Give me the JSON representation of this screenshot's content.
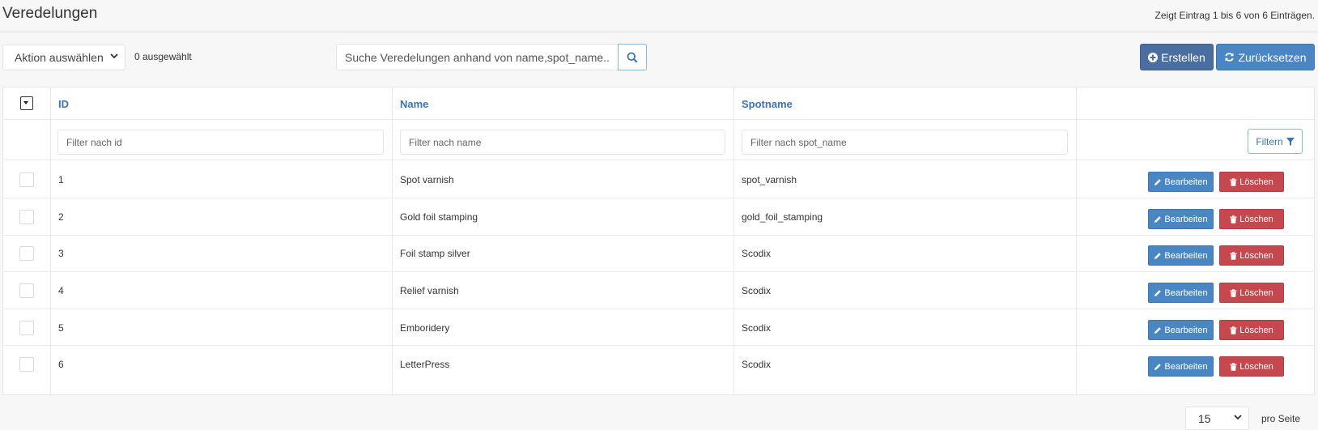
{
  "page": {
    "title": "Veredelungen",
    "summary": "Zeigt Eintrag 1 bis 6 von 6 Einträgen."
  },
  "toolbar": {
    "action_select": "Aktion auswählen",
    "selected_count": "0 ausgewählt",
    "search_placeholder": "Suche Veredelungen anhand von name,spot_name...",
    "create_label": "Erstellen",
    "reset_label": "Zurücksetzen"
  },
  "table": {
    "columns": [
      "ID",
      "Name",
      "Spotname"
    ],
    "filters": {
      "id_placeholder": "Filter nach id",
      "name_placeholder": "Filter nach name",
      "spot_placeholder": "Filter nach spot_name",
      "filter_button": "Filtern"
    },
    "edit_label": "Bearbeiten",
    "delete_label": "Löschen",
    "rows": [
      {
        "id": "1",
        "name": "Spot varnish",
        "spotname": "spot_varnish"
      },
      {
        "id": "2",
        "name": "Gold foil stamping",
        "spotname": "gold_foil_stamping"
      },
      {
        "id": "3",
        "name": "Foil stamp silver",
        "spotname": "Scodix"
      },
      {
        "id": "4",
        "name": "Relief varnish",
        "spotname": "Scodix"
      },
      {
        "id": "5",
        "name": "Emboridery",
        "spotname": "Scodix"
      },
      {
        "id": "6",
        "name": "LetterPress",
        "spotname": "Scodix"
      }
    ]
  },
  "pagination": {
    "per_page_value": "15",
    "per_page_label": "pro Seite"
  },
  "icons": {
    "search": "search-icon",
    "create": "plus-circle-icon",
    "reset": "refresh-icon",
    "filter": "filter-icon",
    "edit": "pencil-icon",
    "delete": "trash-icon",
    "dropdown": "chevron-down-icon"
  },
  "colors": {
    "link_blue": "#3a74b0",
    "create_bg": "#4a6ea0",
    "primary_bg": "#4a86c3",
    "danger_bg": "#c6484f"
  }
}
